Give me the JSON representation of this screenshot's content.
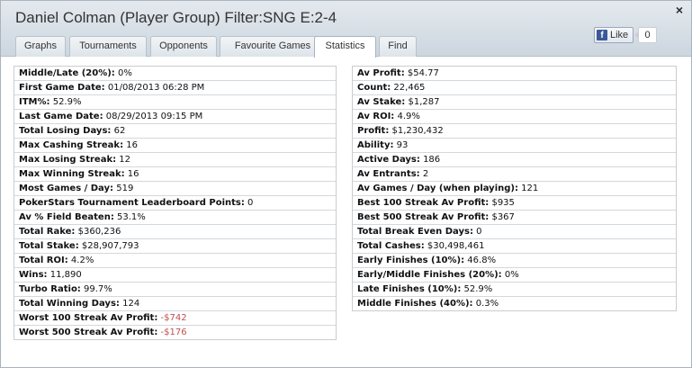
{
  "window": {
    "title": "Daniel Colman (Player Group) Filter:SNG E:2-4",
    "close_glyph": "×"
  },
  "tabs": [
    {
      "label": "Graphs",
      "active": false
    },
    {
      "label": "Tournaments",
      "active": false
    },
    {
      "label": "Opponents",
      "active": false
    },
    {
      "label": "Favourite Games",
      "active": false
    },
    {
      "label": "Statistics",
      "active": true
    },
    {
      "label": "Find",
      "active": false
    }
  ],
  "facebook": {
    "icon": "facebook-icon",
    "icon_glyph": "f",
    "like_label": "Like",
    "count": "0"
  },
  "colors": {
    "negative": "#c0504d",
    "facebook_blue": "#3b5998"
  },
  "left_stats": [
    {
      "label": "Middle/Late (20%):",
      "value": "0%"
    },
    {
      "label": "First Game Date:",
      "value": "01/08/2013 06:28 PM"
    },
    {
      "label": "ITM%:",
      "value": "52.9%"
    },
    {
      "label": "Last Game Date:",
      "value": "08/29/2013 09:15 PM"
    },
    {
      "label": "Total Losing Days:",
      "value": "62"
    },
    {
      "label": "Max Cashing Streak:",
      "value": "16"
    },
    {
      "label": "Max Losing Streak:",
      "value": "12"
    },
    {
      "label": "Max Winning Streak:",
      "value": "16"
    },
    {
      "label": "Most Games / Day:",
      "value": "519"
    },
    {
      "label": "PokerStars Tournament Leaderboard Points:",
      "value": "0"
    },
    {
      "label": "Av % Field Beaten:",
      "value": "53.1%"
    },
    {
      "label": "Total Rake:",
      "value": "$360,236"
    },
    {
      "label": "Total Stake:",
      "value": "$28,907,793"
    },
    {
      "label": "Total ROI:",
      "value": "4.2%"
    },
    {
      "label": "Wins:",
      "value": "11,890"
    },
    {
      "label": "Turbo Ratio:",
      "value": "99.7%"
    },
    {
      "label": "Total Winning Days:",
      "value": "124"
    },
    {
      "label": "Worst 100 Streak Av Profit:",
      "value": "-$742",
      "negative": true
    },
    {
      "label": "Worst 500 Streak Av Profit:",
      "value": "-$176",
      "negative": true
    }
  ],
  "right_stats": [
    {
      "label": "Av Profit:",
      "value": "$54.77"
    },
    {
      "label": "Count:",
      "value": "22,465"
    },
    {
      "label": "Av Stake:",
      "value": "$1,287"
    },
    {
      "label": "Av ROI:",
      "value": "4.9%"
    },
    {
      "label": "Profit:",
      "value": "$1,230,432"
    },
    {
      "label": "Ability:",
      "value": "93"
    },
    {
      "label": "Active Days:",
      "value": "186"
    },
    {
      "label": "Av Entrants:",
      "value": "2"
    },
    {
      "label": "Av Games / Day (when playing):",
      "value": "121"
    },
    {
      "label": "Best 100 Streak Av Profit:",
      "value": "$935"
    },
    {
      "label": "Best 500 Streak Av Profit:",
      "value": "$367"
    },
    {
      "label": "Total Break Even Days:",
      "value": "0"
    },
    {
      "label": "Total Cashes:",
      "value": "$30,498,461"
    },
    {
      "label": "Early Finishes (10%):",
      "value": "46.8%"
    },
    {
      "label": "Early/Middle Finishes (20%):",
      "value": "0%"
    },
    {
      "label": "Late Finishes (10%):",
      "value": "52.9%"
    },
    {
      "label": "Middle Finishes (40%):",
      "value": "0.3%"
    }
  ]
}
